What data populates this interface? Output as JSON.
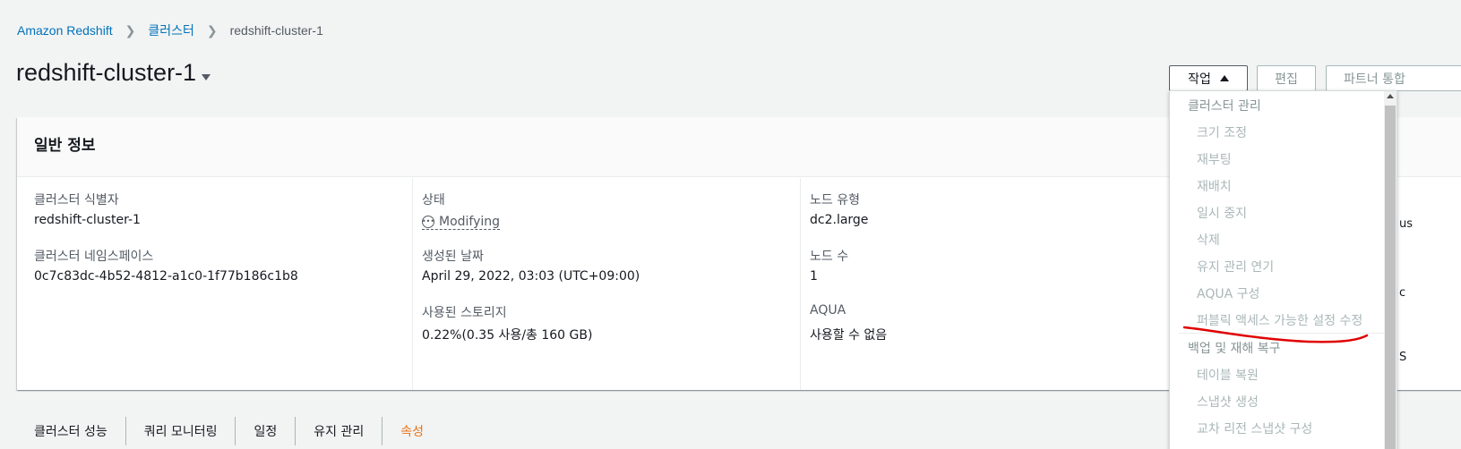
{
  "breadcrumb": {
    "items": [
      "Amazon Redshift",
      "클러스터"
    ],
    "current": "redshift-cluster-1"
  },
  "page": {
    "title": "redshift-cluster-1"
  },
  "buttons": {
    "actions": "작업",
    "edit": "편집",
    "partner": "파트너 통합"
  },
  "general_info": {
    "title": "일반 정보",
    "col1": [
      {
        "label": "클러스터 식별자",
        "value": "redshift-cluster-1"
      },
      {
        "label": "클러스터 네임스페이스",
        "value": "0c7c83dc-4b52-4812-a1c0-1f77b186c1b8"
      }
    ],
    "col2": [
      {
        "label": "상태",
        "value": "Modifying"
      },
      {
        "label": "생성된 날짜",
        "value": "April 29, 2022, 03:03 (UTC+09:00)"
      },
      {
        "label": "사용된 스토리지",
        "value": "0.22%(0.35 사용/총 160 GB)"
      }
    ],
    "col3": [
      {
        "label": "노드 유형",
        "value": "dc2.large"
      },
      {
        "label": "노드 수",
        "value": "1"
      },
      {
        "label": "AQUA",
        "value": "사용할 수 없음"
      }
    ]
  },
  "tabs": [
    "클러스터 성능",
    "쿼리 모니터링",
    "일정",
    "유지 관리",
    "속성"
  ],
  "dropdown": {
    "group1": "클러스터 관리",
    "group1_items": [
      "크기 조정",
      "재부팅",
      "재배치",
      "일시 중지",
      "삭제",
      "유지 관리 연기",
      "AQUA 구성",
      "퍼블릭 액세스 가능한 설정 수정"
    ],
    "group2": "백업 및 재해 복구",
    "group2_items": [
      "테이블 복원",
      "스냅샷 생성",
      "교차 리전 스냅샷 구성"
    ]
  },
  "right_edge": [
    "us",
    "c",
    "S"
  ],
  "colors": {
    "link": "#0073bb",
    "accent": "#ec7211",
    "annotation": "#e00000"
  }
}
